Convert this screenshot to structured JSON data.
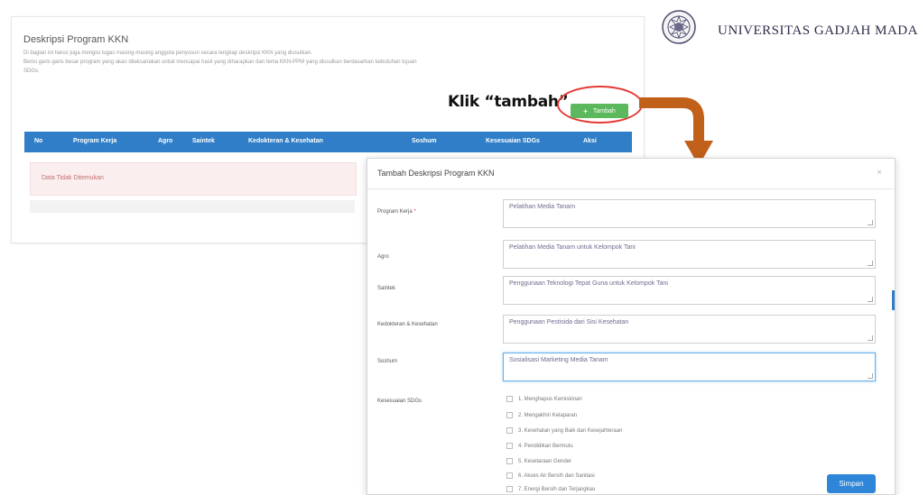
{
  "page": {
    "section_title": "Deskripsi Program KKN",
    "description_lines": [
      "Di bagian ini harus juga mengisi tugas masing-masing anggota penyusun secara lengkap deskripsi KKN yang diusulkan.",
      "Berisi garis-garis besar program yang akan dilaksanakan untuk mencapai hasil yang diharapkan dan tema KKN-PPM yang diusulkan berdasarkan kebutuhan tujuan",
      "SDGs."
    ],
    "add_button_label": "Tambah",
    "annotation": "Klik “tambah”"
  },
  "logo": {
    "name": "UNIVERSITAS GADJAH MADA"
  },
  "table": {
    "headers": [
      "No",
      "Program Kerja",
      "Agro",
      "Saintek",
      "Kedokteran & Kesehatan",
      "Soshum",
      "Kesesuaian SDGs",
      "Aksi"
    ],
    "empty_message": "Data Tidak Ditemukan"
  },
  "modal": {
    "title": "Tambah Deskripsi Program KKN",
    "close": "×",
    "fields": [
      {
        "label": "Program Kerja",
        "required_mark": "*",
        "value": "Pelatihan Media Tanam"
      },
      {
        "label": "Agro",
        "value": "Pelatihan Media Tanam untuk Kelompok Tani"
      },
      {
        "label": "Saintek",
        "value": "Penggunaan Teknologi Tepat Guna untuk Kelompok Tani"
      },
      {
        "label": "Kedokteran & Kesehatan",
        "value": "Penggunaan Pestisida dari Sisi Kesehatan"
      },
      {
        "label": "Soshum",
        "value": "Sosialisasi Marketing Media Tanam"
      }
    ],
    "sdgs_label": "Kesesuaian SDGs",
    "sdgs_options": [
      "1. Menghapus Kemiskinan",
      "2. Mengakhiri Kelaparan",
      "3. Kesehatan yang Baik dan Kesejahteraan",
      "4. Pendidikan Bermutu",
      "5. Kesetaraan Gender",
      "6. Akses Air Bersih dan Sanitasi",
      "7. Energi Bersih dan Terjangkau"
    ],
    "save_label": "Simpan"
  },
  "colors": {
    "primary": "#2f7ec7",
    "success": "#5cb85c",
    "annotation_circle": "#e53935",
    "arrow": "#c0601a"
  }
}
